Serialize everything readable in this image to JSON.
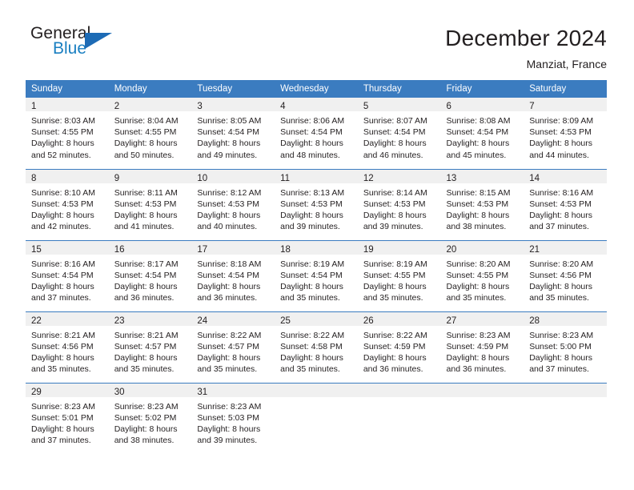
{
  "brand": {
    "name_dark": "General",
    "name_blue": "Blue",
    "accent_color": "#1d6bb5"
  },
  "header": {
    "title": "December 2024",
    "subtitle": "Manziat, France"
  },
  "calendar": {
    "header_color": "#3b7cc0",
    "weekday_headers": [
      "Sunday",
      "Monday",
      "Tuesday",
      "Wednesday",
      "Thursday",
      "Friday",
      "Saturday"
    ],
    "weeks": [
      [
        {
          "day": "1",
          "sunrise": "Sunrise: 8:03 AM",
          "sunset": "Sunset: 4:55 PM",
          "daylight1": "Daylight: 8 hours",
          "daylight2": "and 52 minutes."
        },
        {
          "day": "2",
          "sunrise": "Sunrise: 8:04 AM",
          "sunset": "Sunset: 4:55 PM",
          "daylight1": "Daylight: 8 hours",
          "daylight2": "and 50 minutes."
        },
        {
          "day": "3",
          "sunrise": "Sunrise: 8:05 AM",
          "sunset": "Sunset: 4:54 PM",
          "daylight1": "Daylight: 8 hours",
          "daylight2": "and 49 minutes."
        },
        {
          "day": "4",
          "sunrise": "Sunrise: 8:06 AM",
          "sunset": "Sunset: 4:54 PM",
          "daylight1": "Daylight: 8 hours",
          "daylight2": "and 48 minutes."
        },
        {
          "day": "5",
          "sunrise": "Sunrise: 8:07 AM",
          "sunset": "Sunset: 4:54 PM",
          "daylight1": "Daylight: 8 hours",
          "daylight2": "and 46 minutes."
        },
        {
          "day": "6",
          "sunrise": "Sunrise: 8:08 AM",
          "sunset": "Sunset: 4:54 PM",
          "daylight1": "Daylight: 8 hours",
          "daylight2": "and 45 minutes."
        },
        {
          "day": "7",
          "sunrise": "Sunrise: 8:09 AM",
          "sunset": "Sunset: 4:53 PM",
          "daylight1": "Daylight: 8 hours",
          "daylight2": "and 44 minutes."
        }
      ],
      [
        {
          "day": "8",
          "sunrise": "Sunrise: 8:10 AM",
          "sunset": "Sunset: 4:53 PM",
          "daylight1": "Daylight: 8 hours",
          "daylight2": "and 42 minutes."
        },
        {
          "day": "9",
          "sunrise": "Sunrise: 8:11 AM",
          "sunset": "Sunset: 4:53 PM",
          "daylight1": "Daylight: 8 hours",
          "daylight2": "and 41 minutes."
        },
        {
          "day": "10",
          "sunrise": "Sunrise: 8:12 AM",
          "sunset": "Sunset: 4:53 PM",
          "daylight1": "Daylight: 8 hours",
          "daylight2": "and 40 minutes."
        },
        {
          "day": "11",
          "sunrise": "Sunrise: 8:13 AM",
          "sunset": "Sunset: 4:53 PM",
          "daylight1": "Daylight: 8 hours",
          "daylight2": "and 39 minutes."
        },
        {
          "day": "12",
          "sunrise": "Sunrise: 8:14 AM",
          "sunset": "Sunset: 4:53 PM",
          "daylight1": "Daylight: 8 hours",
          "daylight2": "and 39 minutes."
        },
        {
          "day": "13",
          "sunrise": "Sunrise: 8:15 AM",
          "sunset": "Sunset: 4:53 PM",
          "daylight1": "Daylight: 8 hours",
          "daylight2": "and 38 minutes."
        },
        {
          "day": "14",
          "sunrise": "Sunrise: 8:16 AM",
          "sunset": "Sunset: 4:53 PM",
          "daylight1": "Daylight: 8 hours",
          "daylight2": "and 37 minutes."
        }
      ],
      [
        {
          "day": "15",
          "sunrise": "Sunrise: 8:16 AM",
          "sunset": "Sunset: 4:54 PM",
          "daylight1": "Daylight: 8 hours",
          "daylight2": "and 37 minutes."
        },
        {
          "day": "16",
          "sunrise": "Sunrise: 8:17 AM",
          "sunset": "Sunset: 4:54 PM",
          "daylight1": "Daylight: 8 hours",
          "daylight2": "and 36 minutes."
        },
        {
          "day": "17",
          "sunrise": "Sunrise: 8:18 AM",
          "sunset": "Sunset: 4:54 PM",
          "daylight1": "Daylight: 8 hours",
          "daylight2": "and 36 minutes."
        },
        {
          "day": "18",
          "sunrise": "Sunrise: 8:19 AM",
          "sunset": "Sunset: 4:54 PM",
          "daylight1": "Daylight: 8 hours",
          "daylight2": "and 35 minutes."
        },
        {
          "day": "19",
          "sunrise": "Sunrise: 8:19 AM",
          "sunset": "Sunset: 4:55 PM",
          "daylight1": "Daylight: 8 hours",
          "daylight2": "and 35 minutes."
        },
        {
          "day": "20",
          "sunrise": "Sunrise: 8:20 AM",
          "sunset": "Sunset: 4:55 PM",
          "daylight1": "Daylight: 8 hours",
          "daylight2": "and 35 minutes."
        },
        {
          "day": "21",
          "sunrise": "Sunrise: 8:20 AM",
          "sunset": "Sunset: 4:56 PM",
          "daylight1": "Daylight: 8 hours",
          "daylight2": "and 35 minutes."
        }
      ],
      [
        {
          "day": "22",
          "sunrise": "Sunrise: 8:21 AM",
          "sunset": "Sunset: 4:56 PM",
          "daylight1": "Daylight: 8 hours",
          "daylight2": "and 35 minutes."
        },
        {
          "day": "23",
          "sunrise": "Sunrise: 8:21 AM",
          "sunset": "Sunset: 4:57 PM",
          "daylight1": "Daylight: 8 hours",
          "daylight2": "and 35 minutes."
        },
        {
          "day": "24",
          "sunrise": "Sunrise: 8:22 AM",
          "sunset": "Sunset: 4:57 PM",
          "daylight1": "Daylight: 8 hours",
          "daylight2": "and 35 minutes."
        },
        {
          "day": "25",
          "sunrise": "Sunrise: 8:22 AM",
          "sunset": "Sunset: 4:58 PM",
          "daylight1": "Daylight: 8 hours",
          "daylight2": "and 35 minutes."
        },
        {
          "day": "26",
          "sunrise": "Sunrise: 8:22 AM",
          "sunset": "Sunset: 4:59 PM",
          "daylight1": "Daylight: 8 hours",
          "daylight2": "and 36 minutes."
        },
        {
          "day": "27",
          "sunrise": "Sunrise: 8:23 AM",
          "sunset": "Sunset: 4:59 PM",
          "daylight1": "Daylight: 8 hours",
          "daylight2": "and 36 minutes."
        },
        {
          "day": "28",
          "sunrise": "Sunrise: 8:23 AM",
          "sunset": "Sunset: 5:00 PM",
          "daylight1": "Daylight: 8 hours",
          "daylight2": "and 37 minutes."
        }
      ],
      [
        {
          "day": "29",
          "sunrise": "Sunrise: 8:23 AM",
          "sunset": "Sunset: 5:01 PM",
          "daylight1": "Daylight: 8 hours",
          "daylight2": "and 37 minutes."
        },
        {
          "day": "30",
          "sunrise": "Sunrise: 8:23 AM",
          "sunset": "Sunset: 5:02 PM",
          "daylight1": "Daylight: 8 hours",
          "daylight2": "and 38 minutes."
        },
        {
          "day": "31",
          "sunrise": "Sunrise: 8:23 AM",
          "sunset": "Sunset: 5:03 PM",
          "daylight1": "Daylight: 8 hours",
          "daylight2": "and 39 minutes."
        },
        {
          "day": "",
          "sunrise": "",
          "sunset": "",
          "daylight1": "",
          "daylight2": ""
        },
        {
          "day": "",
          "sunrise": "",
          "sunset": "",
          "daylight1": "",
          "daylight2": ""
        },
        {
          "day": "",
          "sunrise": "",
          "sunset": "",
          "daylight1": "",
          "daylight2": ""
        },
        {
          "day": "",
          "sunrise": "",
          "sunset": "",
          "daylight1": "",
          "daylight2": ""
        }
      ]
    ]
  }
}
